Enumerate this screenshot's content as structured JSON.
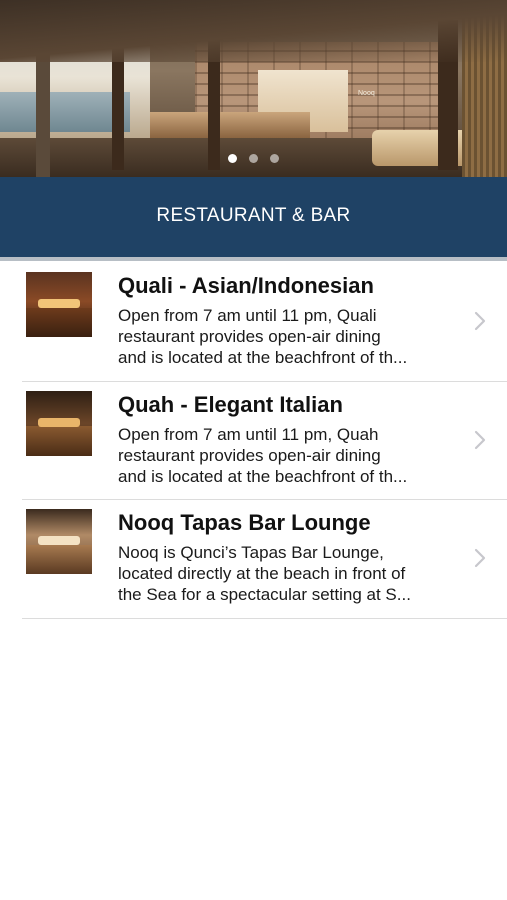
{
  "hero": {
    "sign_text": "Nooq",
    "slides": [
      "slide-1",
      "slide-2",
      "slide-3"
    ],
    "active_slide": 0
  },
  "header": {
    "title": "RESTAURANT & BAR"
  },
  "colors": {
    "header_bg": "#1f4265",
    "header_text": "#ffffff",
    "divider": "#dcdcdc",
    "chevron": "#c7c7cc"
  },
  "items": [
    {
      "title": "Quali - Asian/Indonesian",
      "desc_lines": [
        "Open from 7 am until 11 pm, Quali",
        "restaurant provides open-air dining",
        "and is located at the beachfront of th..."
      ],
      "thumb_icon": "restaurant-photo"
    },
    {
      "title": "Quah - Elegant Italian",
      "desc_lines": [
        "Open from 7 am until 11 pm, Quah",
        "restaurant provides open-air dining",
        "and is located at the beachfront of th..."
      ],
      "thumb_icon": "restaurant-photo"
    },
    {
      "title": "Nooq Tapas Bar Lounge",
      "desc_lines": [
        "Nooq is Qunci’s Tapas Bar Lounge,",
        "located directly at the beach in front of",
        "the Sea for a spectacular setting at S..."
      ],
      "thumb_icon": "bar-lounge-photo"
    }
  ]
}
